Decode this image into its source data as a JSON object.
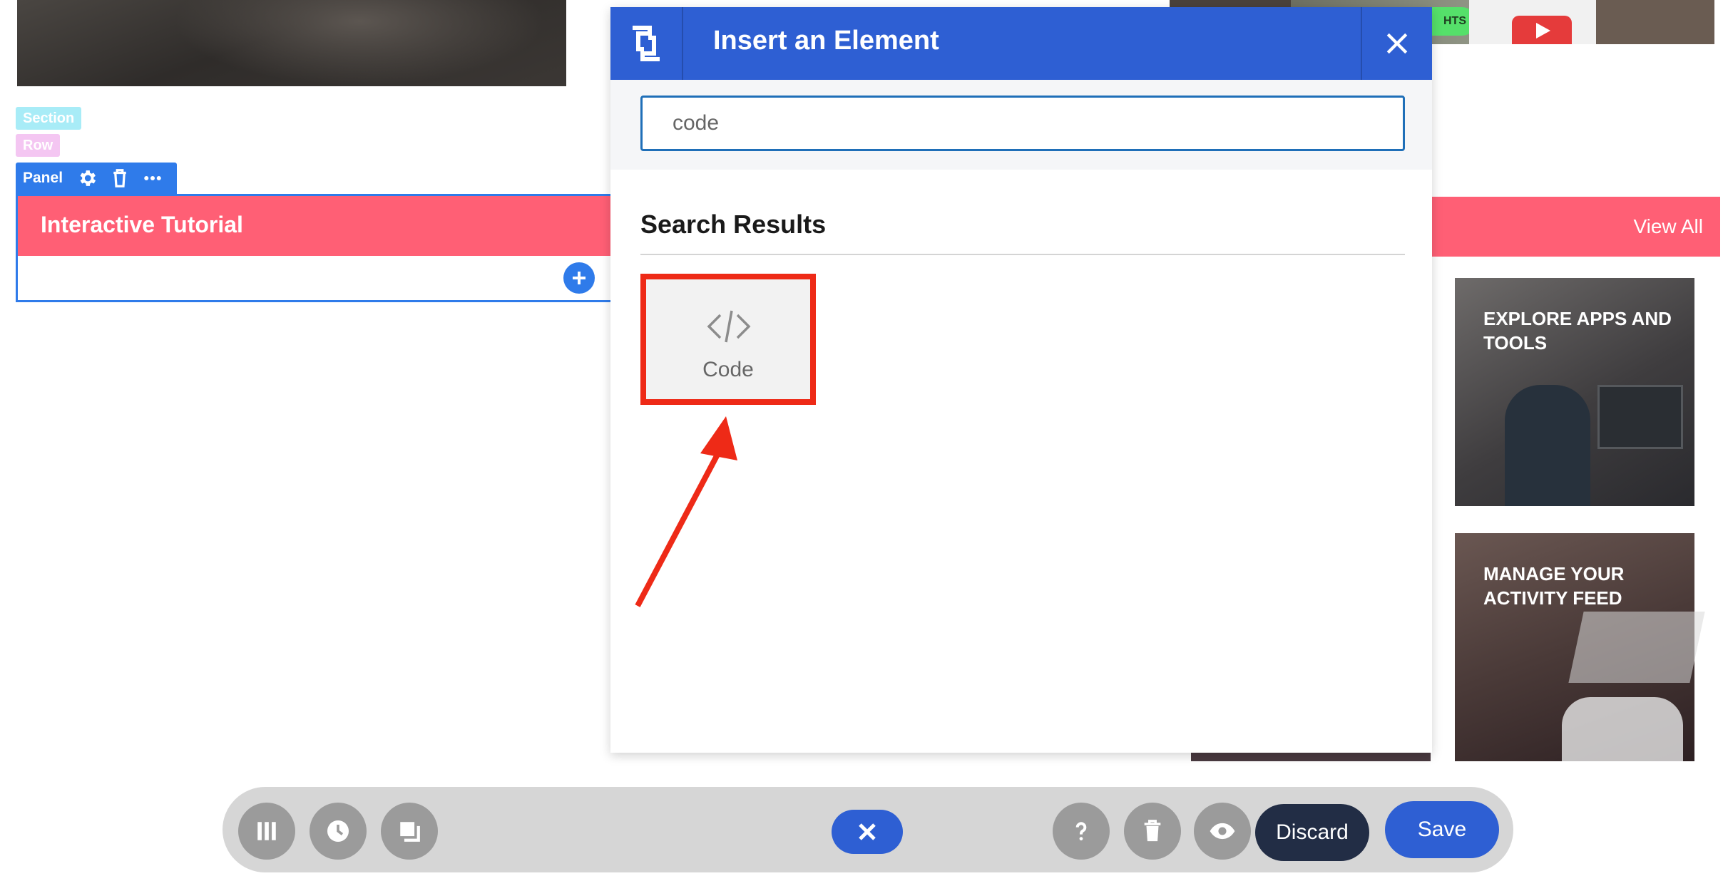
{
  "canvas": {
    "section_tag": "Section",
    "row_tag": "Row",
    "panel_tag": "Panel",
    "panel_title": "Interactive Tutorial",
    "view_all": "View All",
    "cards": [
      {
        "title": "EXPLORE APPS AND TOOLS"
      },
      {
        "title": "MANAGE YOUR ACTIVITY FEED"
      }
    ],
    "top_badge": "HTS"
  },
  "modal": {
    "title": "Insert an Element",
    "search_value": "code",
    "results_heading": "Search Results",
    "results": [
      {
        "label": "Code",
        "icon": "code-icon"
      }
    ]
  },
  "toolbar": {
    "discard_label": "Discard",
    "save_label": "Save"
  },
  "colors": {
    "accent": "#2e5fd3",
    "panel_header": "#ff5f75",
    "highlight": "#ee2a17",
    "discard": "#222d45"
  }
}
